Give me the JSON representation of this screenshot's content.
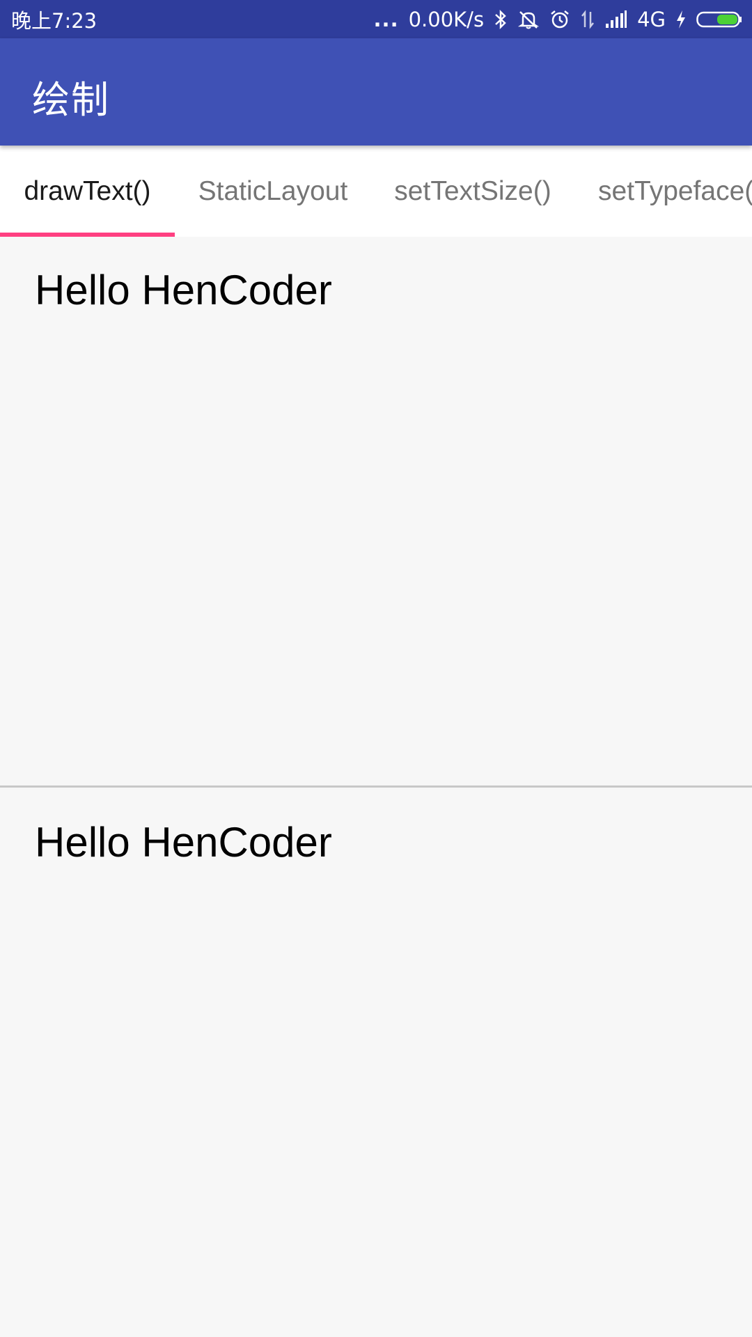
{
  "status_bar": {
    "time": "晚上7:23",
    "dots": "...",
    "net_speed": "0.00K/s",
    "network": "4G",
    "icons": [
      "bluetooth-icon",
      "mute-icon",
      "alarm-icon",
      "data-arrows-icon",
      "signal-icon",
      "charging-icon",
      "battery-icon"
    ],
    "battery_color": "#4cd137"
  },
  "app_bar": {
    "title": "绘制",
    "color": "#3f51b5"
  },
  "tabs": [
    {
      "label": "drawText()",
      "active": true
    },
    {
      "label": "StaticLayout",
      "active": false
    },
    {
      "label": "setTextSize()",
      "active": false
    },
    {
      "label": "setTypeface()",
      "active": false
    }
  ],
  "indicator_color": "#ff4081",
  "panels": [
    {
      "text": "Hello HenCoder"
    },
    {
      "text": "Hello HenCoder"
    }
  ]
}
